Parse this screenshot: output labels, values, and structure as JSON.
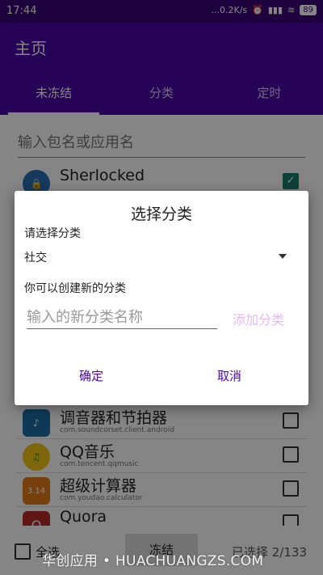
{
  "statusbar": {
    "time": "17:44",
    "net_speed": "...0.2K/s",
    "battery": "89"
  },
  "appbar": {
    "title": "主页"
  },
  "tabs": [
    "未冻结",
    "分类",
    "定时"
  ],
  "search": {
    "placeholder": "输入包名或应用名"
  },
  "apps": [
    {
      "name": "Sherlocked",
      "package": "",
      "checked": true,
      "icon": "sherlocked-icon",
      "color": "#2a6fb5"
    },
    {
      "name": "调音器和节拍器",
      "package": "com.soundcorset.client.android",
      "checked": false,
      "icon": "music-note-icon",
      "color": "#1b6fa8"
    },
    {
      "name": "QQ音乐",
      "package": "com.tencent.qqmusic",
      "checked": false,
      "icon": "qqmusic-icon",
      "color": "#f2c514"
    },
    {
      "name": "超级计算器",
      "package": "com.youdao.calculator",
      "checked": false,
      "icon": "calculator-icon",
      "color": "#e07b16"
    },
    {
      "name": "Quora",
      "package": "",
      "checked": false,
      "icon": "quora-icon",
      "color": "#b92b27"
    }
  ],
  "bottom": {
    "select_all": "全选",
    "freeze": "冻结",
    "count": "已选择 2/133"
  },
  "watermark": "华创应用 • HUACHUANGZS.COM",
  "dialog": {
    "title": "选择分类",
    "label_choose": "请选择分类",
    "selected_category": "社交",
    "label_create": "你可以创建新的分类",
    "input_placeholder": "输入的新分类名称",
    "add_label": "添加分类",
    "ok_label": "确定",
    "cancel_label": "取消"
  },
  "colors": {
    "primary": "#4a06a5",
    "accent": "#1a7f6d",
    "add_disabled": "#e3b9f4"
  }
}
